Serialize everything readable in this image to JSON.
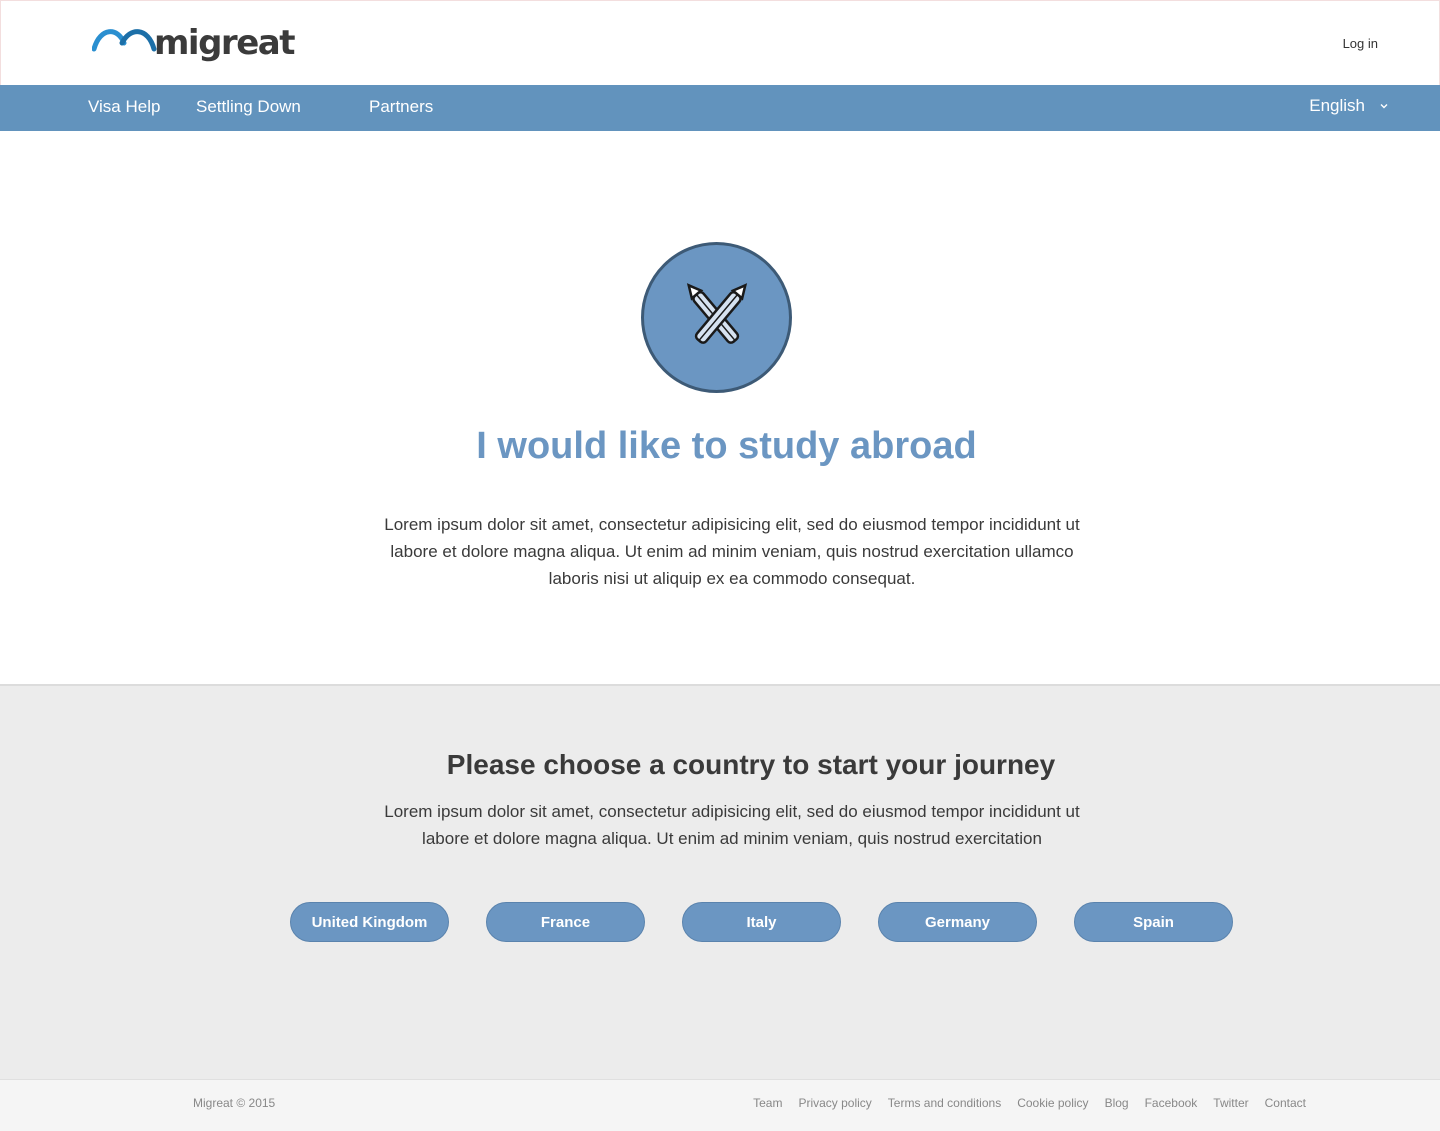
{
  "header": {
    "brand": "migreat",
    "login_label": "Log in"
  },
  "nav": {
    "items": [
      {
        "label": "Visa Help"
      },
      {
        "label": "Settling Down"
      },
      {
        "label": "Partners"
      }
    ],
    "language": "English"
  },
  "hero": {
    "icon": "crossed-pencils-icon",
    "title": "I would like to study abroad",
    "text": "Lorem ipsum dolor sit amet, consectetur adipisicing elit, sed do eiusmod tempor incididunt ut labore et dolore magna aliqua. Ut enim ad minim veniam, quis nostrud exercitation ullamco laboris nisi ut aliquip ex ea commodo consequat."
  },
  "choose": {
    "title": "Please choose a country to start your journey",
    "text": "Lorem ipsum dolor sit amet, consectetur adipisicing elit, sed do eiusmod tempor incididunt ut labore et dolore magna aliqua. Ut enim ad minim veniam, quis nostrud exercitation",
    "countries": [
      "United Kingdom",
      "France",
      "Italy",
      "Germany",
      "Spain"
    ]
  },
  "footer": {
    "copyright": "Migreat © 2015",
    "links": [
      "Team",
      "Privacy policy",
      "Terms and conditions",
      "Cookie policy",
      "Blog",
      "Facebook",
      "Twitter",
      "Contact"
    ]
  },
  "colors": {
    "accent": "#6293bd",
    "badge": "#6b96c2",
    "section_bg": "#ececec"
  }
}
